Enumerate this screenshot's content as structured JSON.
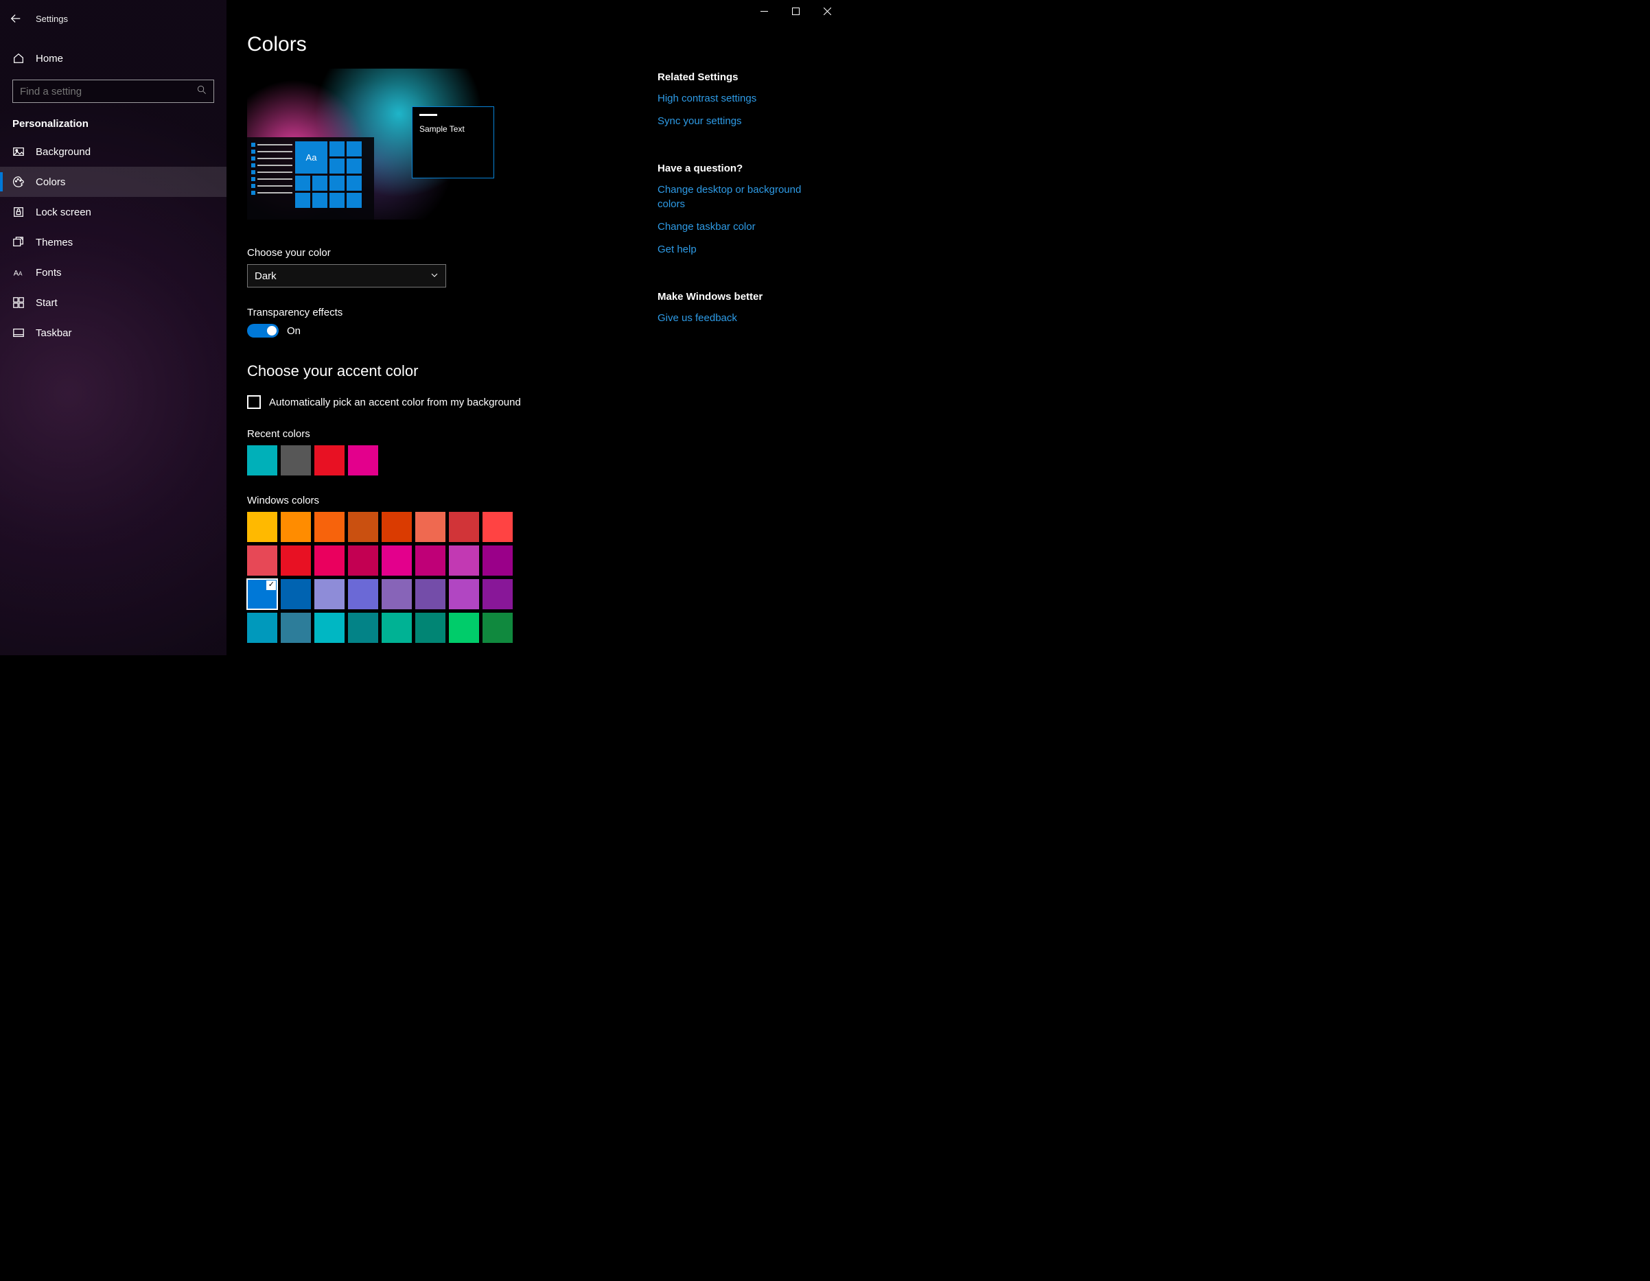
{
  "app_title": "Settings",
  "home_label": "Home",
  "search_placeholder": "Find a setting",
  "section_label": "Personalization",
  "nav": [
    {
      "label": "Background"
    },
    {
      "label": "Colors"
    },
    {
      "label": "Lock screen"
    },
    {
      "label": "Themes"
    },
    {
      "label": "Fonts"
    },
    {
      "label": "Start"
    },
    {
      "label": "Taskbar"
    }
  ],
  "page_title": "Colors",
  "preview": {
    "sample_text": "Sample Text",
    "tile_text": "Aa"
  },
  "choose_color_label": "Choose your color",
  "color_mode_value": "Dark",
  "transparency_label": "Transparency effects",
  "transparency_state": "On",
  "accent_heading": "Choose your accent color",
  "auto_pick_label": "Automatically pick an accent color from my background",
  "recent_label": "Recent colors",
  "recent_colors": [
    "#00b0b9",
    "#575757",
    "#e81123",
    "#e3008c"
  ],
  "windows_colors_label": "Windows colors",
  "windows_colors": [
    "#ffb900",
    "#ff8c00",
    "#f7630c",
    "#ca5010",
    "#da3b01",
    "#ef6950",
    "#d13438",
    "#ff4343",
    "#e74856",
    "#e81123",
    "#ea005e",
    "#c30052",
    "#e3008c",
    "#bf0077",
    "#c239b3",
    "#9a0089",
    "#0078d7",
    "#0063b1",
    "#8e8cd8",
    "#6b69d6",
    "#8764b8",
    "#744da9",
    "#b146c2",
    "#881798",
    "#0099bc",
    "#2d7d9a",
    "#00b7c3",
    "#038387",
    "#00b294",
    "#018574",
    "#00cc6a",
    "#10893e"
  ],
  "selected_color_index": 16,
  "side": {
    "related_heading": "Related Settings",
    "links_related": [
      "High contrast settings",
      "Sync your settings"
    ],
    "question_heading": "Have a question?",
    "links_question": [
      "Change desktop or background colors",
      "Change taskbar color",
      "Get help"
    ],
    "better_heading": "Make Windows better",
    "links_better": [
      "Give us feedback"
    ]
  }
}
